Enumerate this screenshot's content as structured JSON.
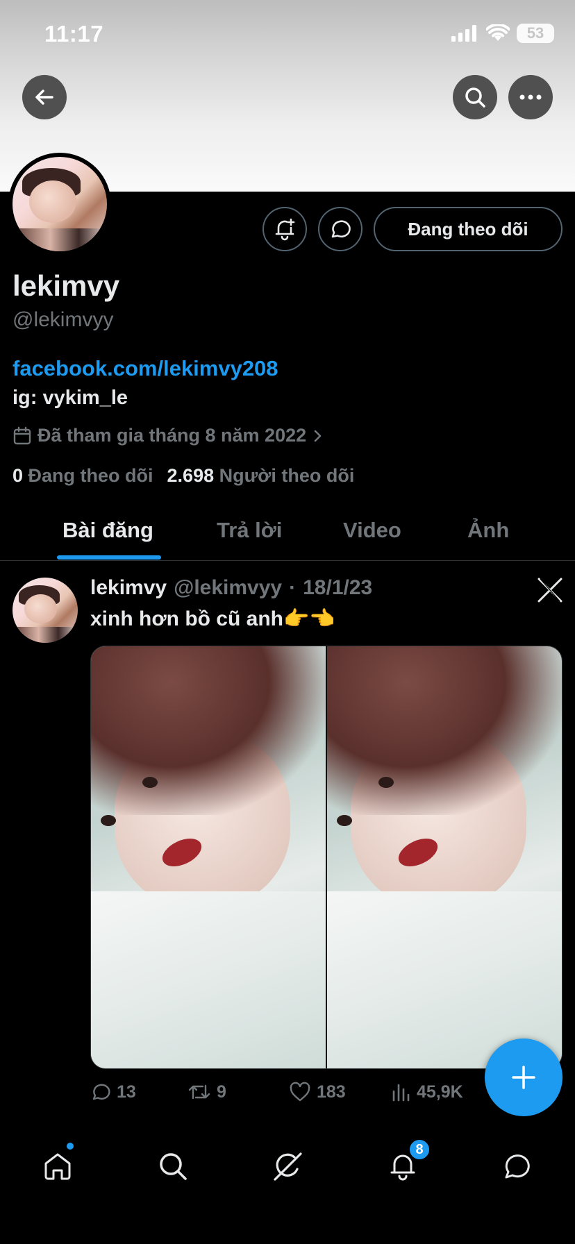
{
  "status_bar": {
    "time": "11:17",
    "battery": "53"
  },
  "profile": {
    "display_name": "lekimvy",
    "handle": "@lekimvyy",
    "bio_link": "facebook.com/lekimvy208",
    "bio_text": "ig: vykim_le",
    "joined": "Đã tham gia tháng 8 năm 2022",
    "following_count": "0",
    "following_label": "Đang theo dõi",
    "followers_count": "2.698",
    "followers_label": "Người theo dõi",
    "follow_button": "Đang theo dõi"
  },
  "tabs": [
    {
      "label": "Bài đăng",
      "active": true
    },
    {
      "label": "Trả lời",
      "active": false
    },
    {
      "label": "Video",
      "active": false
    },
    {
      "label": "Ảnh",
      "active": false
    }
  ],
  "post": {
    "name": "lekimvy",
    "handle": "@lekimvyy",
    "separator": "·",
    "date": "18/1/23",
    "text": "xinh hơn bồ cũ anh👉👈",
    "replies": "13",
    "reposts": "9",
    "likes": "183",
    "views": "45,9K"
  },
  "bottom_nav": {
    "notifications_badge": "8"
  },
  "colors": {
    "accent": "#1d9bf0",
    "background": "#000000",
    "muted": "#71767b",
    "border": "#2f3336"
  }
}
